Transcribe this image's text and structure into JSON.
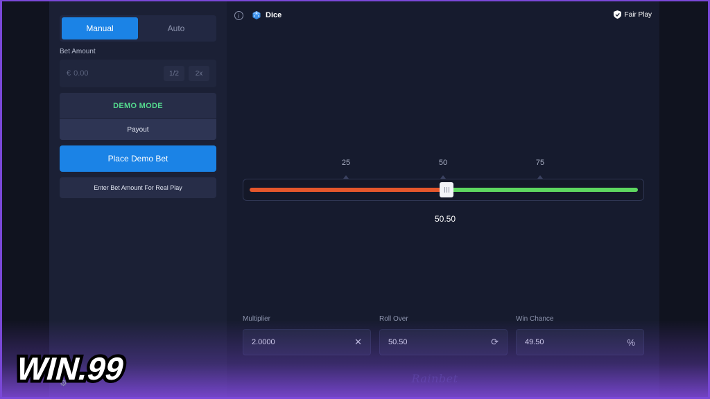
{
  "sidebar": {
    "tabs": [
      {
        "label": "Manual",
        "active": true
      },
      {
        "label": "Auto",
        "active": false
      }
    ],
    "bet_amount_label": "Bet Amount",
    "bet_currency": "€",
    "bet_value": "0.00",
    "half_label": "1/2",
    "double_label": "2x",
    "demo_mode_label": "DEMO MODE",
    "payout_label": "Payout",
    "place_bet_label": "Place Demo Bet",
    "real_play_label": "Enter Bet Amount For Real Play"
  },
  "header": {
    "info_icon": "info-icon",
    "game_icon": "dice-icon",
    "game_title": "Dice",
    "fair_play_icon": "shield-check-icon",
    "fair_play_label": "Fair Play"
  },
  "slider": {
    "ticks": [
      "25",
      "50",
      "75"
    ],
    "value": "50.50",
    "position_percent": 50.5,
    "lose_color": "#e5572c",
    "win_color": "#5ed760"
  },
  "fields": {
    "multiplier": {
      "label": "Multiplier",
      "value": "2.0000",
      "suffix": "✕"
    },
    "roll_over": {
      "label": "Roll Over",
      "value": "50.50",
      "suffix": "⟳"
    },
    "win_chance": {
      "label": "Win Chance",
      "value": "49.50",
      "suffix": "%"
    }
  },
  "brand": {
    "provider": "Rainbet",
    "watermark": "WIN.99"
  },
  "colors": {
    "accent": "#1b83e6",
    "demo": "#54d98e",
    "border": "#7a48d8"
  }
}
